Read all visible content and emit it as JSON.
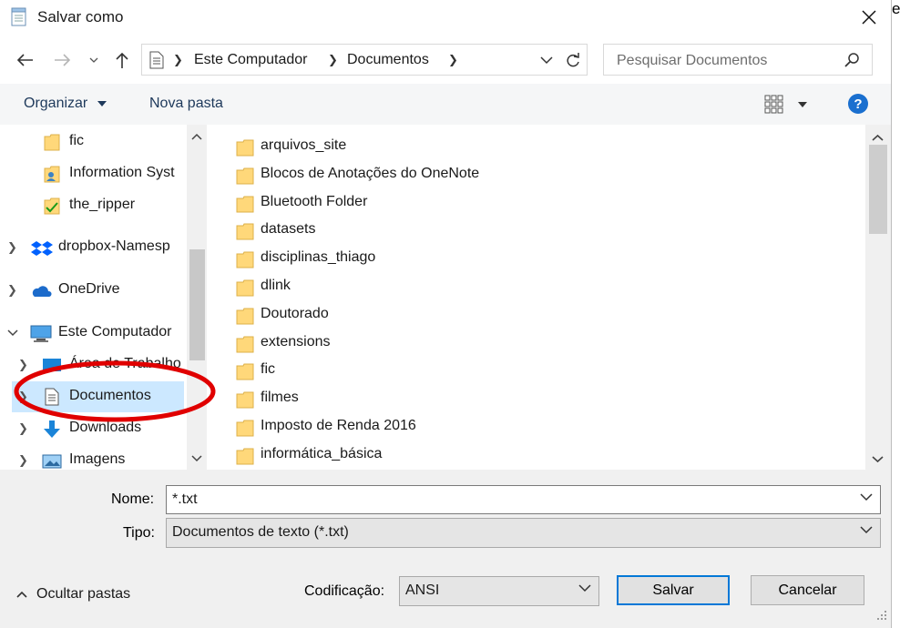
{
  "window": {
    "title": "Salvar como",
    "edge_text": "e"
  },
  "address_bar": {
    "crumbs": [
      "Este Computador",
      "Documentos"
    ]
  },
  "search": {
    "placeholder": "Pesquisar Documentos"
  },
  "commands": {
    "organize_label": "Organizar",
    "new_folder_label": "Nova pasta"
  },
  "nav_pane": {
    "items": [
      {
        "label": "fic",
        "icon": "folder-icon"
      },
      {
        "label": "Information Syst",
        "icon": "shared-folder-icon"
      },
      {
        "label": "the_ripper",
        "icon": "synced-folder-icon"
      },
      {
        "label": "dropbox-Namesp",
        "icon": "dropbox-icon"
      },
      {
        "label": "OneDrive",
        "icon": "onedrive-icon"
      },
      {
        "label": "Este Computador",
        "icon": "computer-icon"
      },
      {
        "label": "Área de Trabalho",
        "icon": "desktop-icon"
      },
      {
        "label": "Documentos",
        "icon": "documents-icon"
      },
      {
        "label": "Downloads",
        "icon": "downloads-icon"
      },
      {
        "label": "Imagens",
        "icon": "pictures-icon"
      }
    ]
  },
  "files": [
    "arquivos_site",
    "Blocos de Anotações do OneNote",
    "Bluetooth Folder",
    "datasets",
    "disciplinas_thiago",
    "dlink",
    "Doutorado",
    "extensions",
    "fic",
    "filmes",
    "Imposto de Renda 2016",
    "informática_básica"
  ],
  "form": {
    "name_label": "Nome:",
    "name_value": "*.txt",
    "type_label": "Tipo:",
    "type_value": "Documentos de texto (*.txt)",
    "encoding_label": "Codificação:",
    "encoding_value": "ANSI"
  },
  "buttons": {
    "save": "Salvar",
    "cancel": "Cancelar",
    "hide_folders": "Ocultar pastas"
  },
  "colors": {
    "selection": "#cce8ff",
    "accent": "#0078d7",
    "annotation": "#e00000",
    "folder": "#ffd87a"
  }
}
